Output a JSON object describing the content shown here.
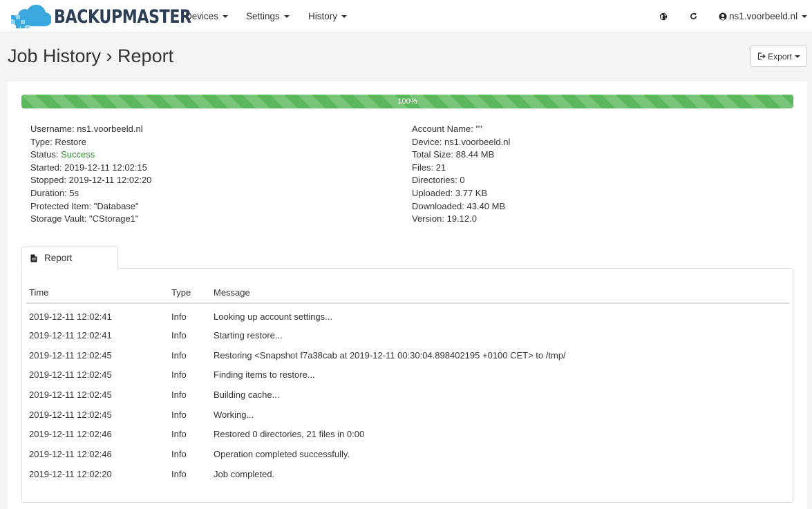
{
  "app": {
    "name": "BACKUPMASTER",
    "accent_color": "#5cb85c",
    "logo_colors": [
      "#38a8e0",
      "#8fd0f0"
    ]
  },
  "nav": {
    "menus": [
      {
        "label": "Devices"
      },
      {
        "label": "Settings"
      },
      {
        "label": "History"
      }
    ],
    "icons": [
      "globe-icon",
      "refresh-icon"
    ],
    "user": "ns1.voorbeeld.nl"
  },
  "page": {
    "title": "Job History › Report",
    "export_label": "Export"
  },
  "progress": {
    "value": 100,
    "label": "100%"
  },
  "details_left": [
    {
      "label": "Username: ",
      "value": "ns1.voorbeeld.nl"
    },
    {
      "label": "Type: ",
      "value": "Restore"
    },
    {
      "label": "Status: ",
      "value": "Success"
    },
    {
      "label": "Started: ",
      "value": "2019-12-11 12:02:15"
    },
    {
      "label": "Stopped: ",
      "value": "2019-12-11 12:02:20"
    },
    {
      "label": "Duration: ",
      "value": "5s"
    },
    {
      "label": "Protected Item: ",
      "value": "\"Database\""
    },
    {
      "label": "Storage Vault: ",
      "value": "\"CStorage1\""
    }
  ],
  "details_right": [
    {
      "label": "Account Name: ",
      "value": "\"\""
    },
    {
      "label": "Device: ",
      "value": "ns1.voorbeeld.nl"
    },
    {
      "label": "Total Size: ",
      "value": "88.44 MB"
    },
    {
      "label": "Files: ",
      "value": "21"
    },
    {
      "label": "Directories: ",
      "value": "0"
    },
    {
      "label": "Uploaded: ",
      "value": "3.77 KB"
    },
    {
      "label": "Downloaded: ",
      "value": "43.40 MB"
    },
    {
      "label": "Version: ",
      "value": "19.12.0"
    }
  ],
  "report": {
    "tab_label": "Report",
    "columns": [
      "Time",
      "Type",
      "Message"
    ],
    "rows": [
      [
        "2019-12-11 12:02:41",
        "Info",
        "Looking up account settings..."
      ],
      [
        "2019-12-11 12:02:41",
        "Info",
        "Starting restore..."
      ],
      [
        "2019-12-11 12:02:45",
        "Info",
        "Restoring <Snapshot f7a38cab at 2019-12-11 00:30:04.898402195 +0100 CET> to /tmp/"
      ],
      [
        "2019-12-11 12:02:45",
        "Info",
        "Finding items to restore..."
      ],
      [
        "2019-12-11 12:02:45",
        "Info",
        "Building cache..."
      ],
      [
        "2019-12-11 12:02:45",
        "Info",
        "Working..."
      ],
      [
        "2019-12-11 12:02:46",
        "Info",
        "Restored 0 directories, 21 files in 0:00"
      ],
      [
        "2019-12-11 12:02:46",
        "Info",
        "Operation completed successfully."
      ],
      [
        "2019-12-11 12:02:20",
        "Info",
        "Job completed."
      ]
    ]
  }
}
